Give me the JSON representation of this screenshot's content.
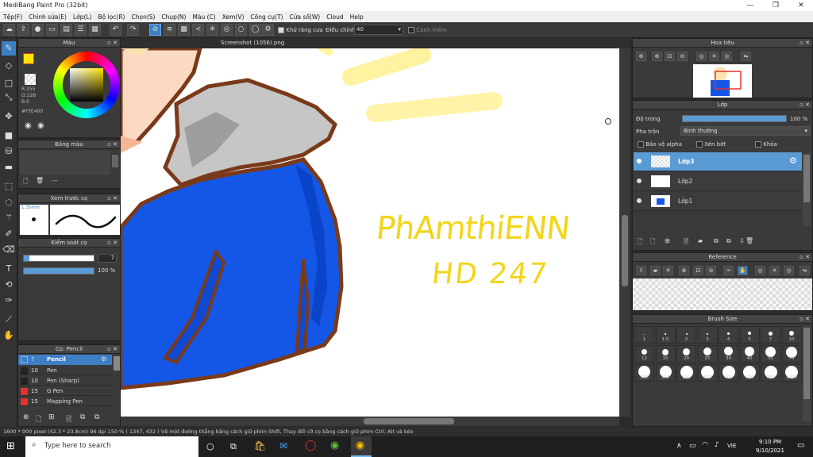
{
  "app": {
    "title": "MediBang Paint Pro (32bit)"
  },
  "menu": [
    "Tệp(F)",
    "Chỉnh sửa(E)",
    "Lớp(L)",
    "Bộ lọc(R)",
    "Chọn(S)",
    "Chụp(N)",
    "Màu (C)",
    "Xem(V)",
    "Công cụ(T)",
    "Cửa sổ(W)",
    "Cloud",
    "Help"
  ],
  "toolbar": {
    "antialias_label": "Khử răng cưa",
    "adjust_label": "Điều chỉnh",
    "adjust_value": "40",
    "snap_label": "Canh mềm"
  },
  "color_panel": {
    "title": "Màu",
    "r": "R:255",
    "g": "G:228",
    "b": "B:0",
    "hex": "#FFE400",
    "accent": "#FFE400"
  },
  "palette_panel": {
    "title": "Bảng màu",
    "dash": "---"
  },
  "brush_preview": {
    "title": "Xem trước cọ",
    "size": "1.35mm"
  },
  "brush_control": {
    "title": "Kiểm soát cọ",
    "size_value": "7",
    "opacity_value": "100 %"
  },
  "brush_list": {
    "title": "Cọ: Pencil",
    "items": [
      {
        "size": "7",
        "name": "Pencil",
        "color": "#3d7fc4"
      },
      {
        "size": "10",
        "name": "Pen",
        "color": "#222222"
      },
      {
        "size": "10",
        "name": "Pen (Sharp)",
        "color": "#222222"
      },
      {
        "size": "15",
        "name": "G Pen",
        "color": "#e53030"
      },
      {
        "size": "15",
        "name": "Mapping Pen",
        "color": "#e53030"
      }
    ]
  },
  "canvas": {
    "tab": "Screenshot (1056).png",
    "text_line1": "PhAmthiENN",
    "text_line2": "HD 247"
  },
  "navigator": {
    "title": "Hoa tiêu"
  },
  "layer_panel": {
    "title": "Lớp",
    "opacity_label": "Độ trong",
    "opacity_value": "100 %",
    "blend_label": "Pha trộn",
    "blend_value": "Bình thường",
    "protect_alpha": "Bảo vệ alpha",
    "clipping": "Xén bớt",
    "lock": "Khóa",
    "layers": [
      "Lớp3",
      "Lớp2",
      "Lớp1"
    ]
  },
  "reference": {
    "title": "Reference"
  },
  "brush_size": {
    "title": "Brush Size",
    "sizes": [
      "1",
      "1.5",
      "2",
      "3",
      "4",
      "5",
      "7",
      "10",
      "12",
      "15",
      "20",
      "25",
      "30",
      "40",
      "50",
      "70",
      "100",
      "150",
      "200",
      "300",
      "400",
      "500",
      "700",
      "1000"
    ]
  },
  "status": {
    "text": "1600 * 900 pixel  (42.3 * 23.8cm)  96 dpi  150 %  ( 1347, 432 )  Vẽ một đường thẳng bằng cách giữ phím Shift, Thay đổi cỡ cọ bằng cách giữ phím Ctrl, Alt và kéo"
  },
  "taskbar": {
    "search_placeholder": "Type here to search",
    "lang": "VIE",
    "time": "9:10 PM",
    "date": "9/10/2021"
  }
}
